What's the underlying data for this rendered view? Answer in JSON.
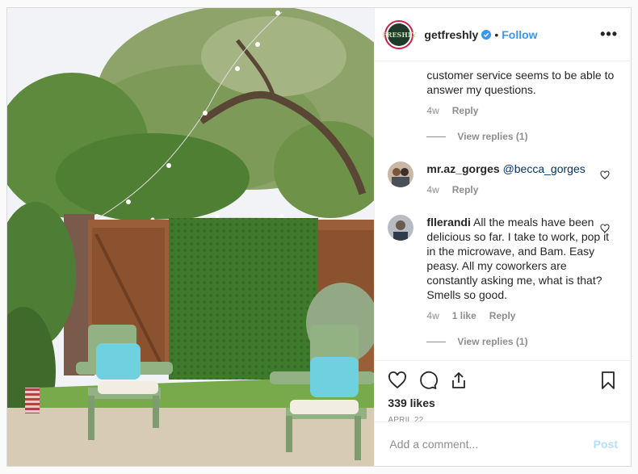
{
  "header": {
    "avatar_text": "FRESHLY",
    "username": "getfreshly",
    "dot": "•",
    "follow": "Follow",
    "more": "•••"
  },
  "comments": {
    "first_tail": "customer service seems to be able to answer my questions.",
    "first_time": "4w",
    "first_reply": "Reply",
    "first_view_replies": "View replies (1)",
    "second_user": "mr.az_gorges",
    "second_mention": "@becca_gorges",
    "second_time": "4w",
    "second_reply": "Reply",
    "third_user": "fllerandi",
    "third_text": "All the meals have been delicious so far. I take to work, pop it in the microwave, and Bam. Easy peasy. All my coworkers are constantly asking me, what is that? Smells so good.",
    "third_time": "4w",
    "third_likes": "1 like",
    "third_reply": "Reply",
    "third_view_replies": "View replies (1)"
  },
  "actions": {
    "likes": "339 likes",
    "date": "APRIL 22"
  },
  "composer": {
    "placeholder": "Add a comment...",
    "post": "Post"
  },
  "colors": {
    "link": "#3897f0",
    "muted": "#8e8e8e",
    "post_disabled": "#b2dffc"
  }
}
